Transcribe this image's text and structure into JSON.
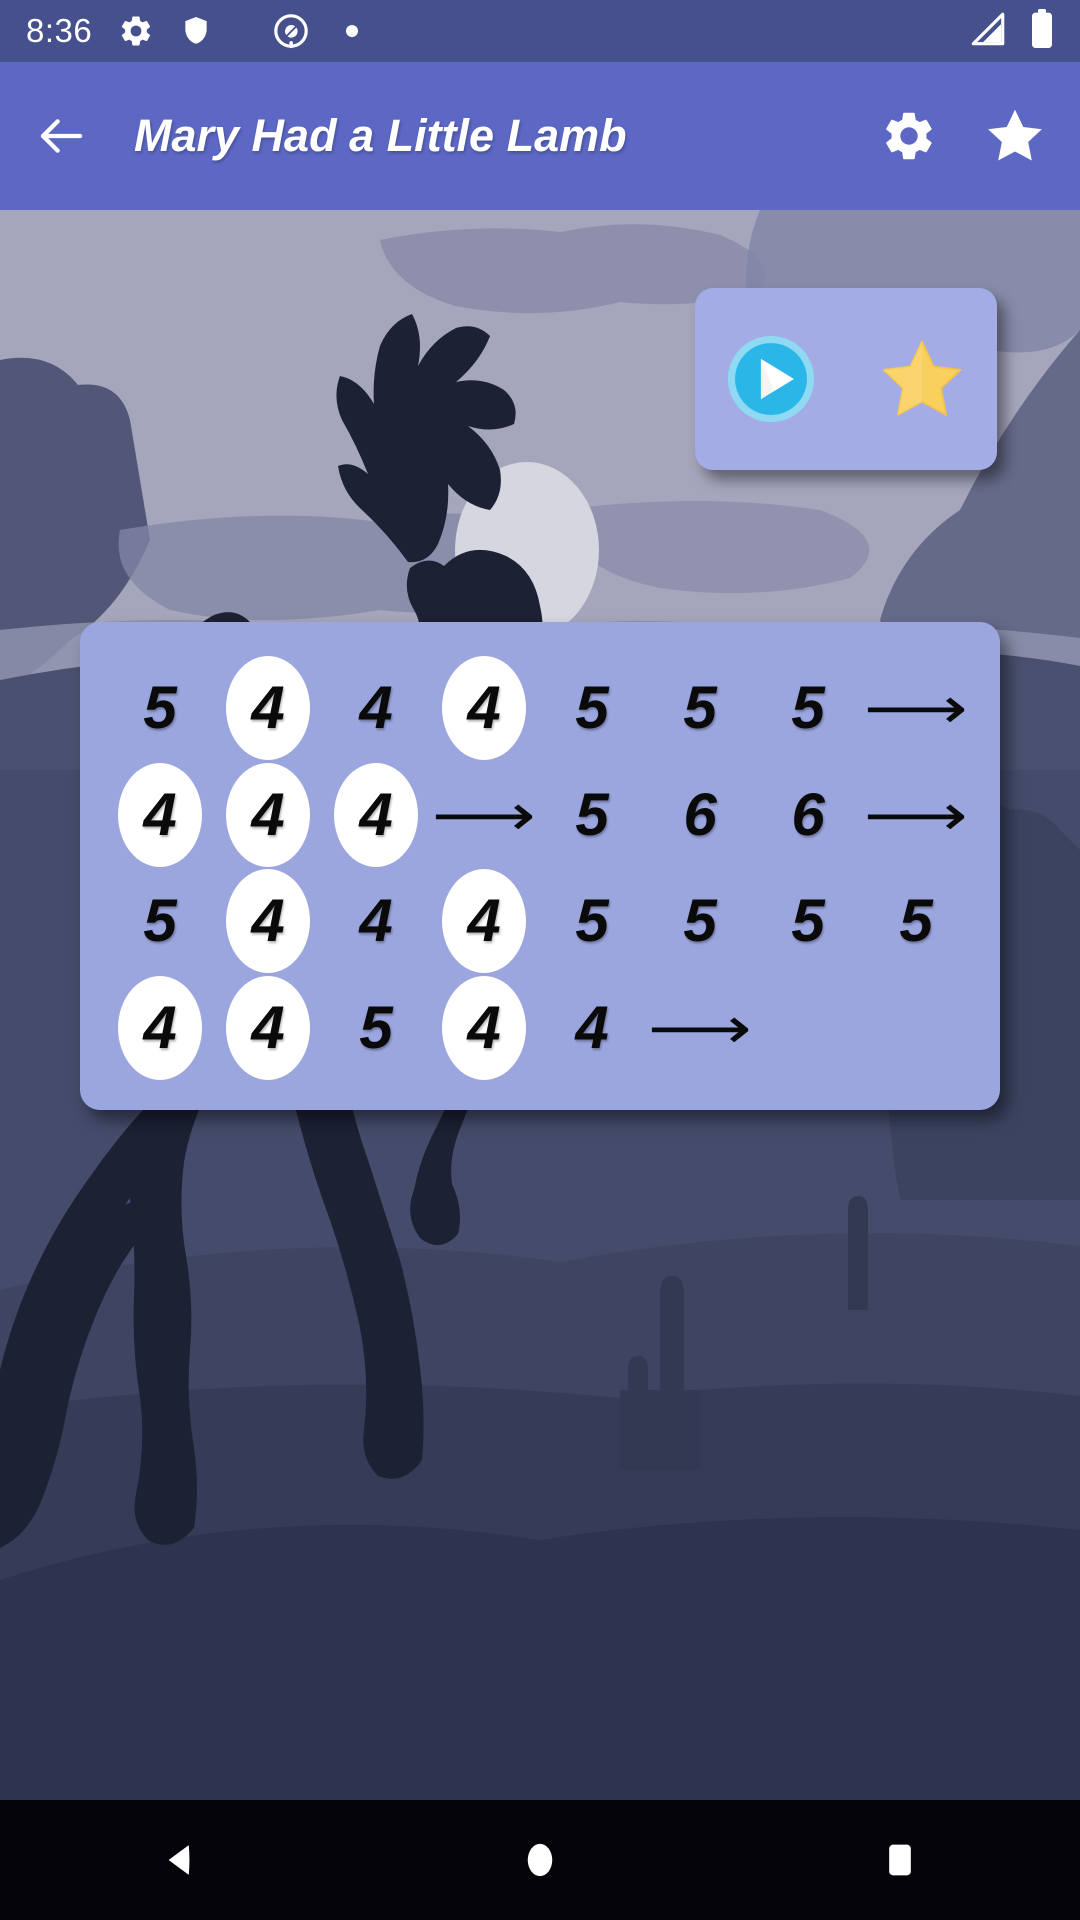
{
  "status_bar": {
    "clock": "8:36",
    "icons": [
      "gear-icon",
      "shield-icon",
      "do-not-disturb-icon",
      "dot-icon"
    ],
    "right_icons": [
      "cell-signal-icon",
      "battery-full-icon"
    ],
    "background_color": "#45508C"
  },
  "app_bar": {
    "back_label": "back-arrow",
    "title": "Mary Had a Little Lamb",
    "actions": [
      "settings-gear",
      "favorite-star"
    ],
    "background_color": "#5C68C4"
  },
  "control_card": {
    "play_label": "play-button",
    "star_label": "favorite-star-button",
    "background_color": "#A3ACE4",
    "play_color": "#29B6E8",
    "star_color": "#F9CF5D"
  },
  "notes_panel": {
    "background_color": "#9BA6DE",
    "arrow_glyph": "⟶",
    "rows": [
      [
        {
          "text": "5",
          "circled": false,
          "type": "note"
        },
        {
          "text": "4",
          "circled": true,
          "type": "note"
        },
        {
          "text": "4",
          "circled": false,
          "type": "note"
        },
        {
          "text": "4",
          "circled": true,
          "type": "note"
        },
        {
          "text": "5",
          "circled": false,
          "type": "note"
        },
        {
          "text": "5",
          "circled": false,
          "type": "note"
        },
        {
          "text": "5",
          "circled": false,
          "type": "note"
        },
        {
          "text": "⟶",
          "circled": false,
          "type": "arrow"
        }
      ],
      [
        {
          "text": "4",
          "circled": true,
          "type": "note"
        },
        {
          "text": "4",
          "circled": true,
          "type": "note"
        },
        {
          "text": "4",
          "circled": true,
          "type": "note"
        },
        {
          "text": "⟶",
          "circled": false,
          "type": "arrow"
        },
        {
          "text": "5",
          "circled": false,
          "type": "note"
        },
        {
          "text": "6",
          "circled": false,
          "type": "note"
        },
        {
          "text": "6",
          "circled": false,
          "type": "note"
        },
        {
          "text": "⟶",
          "circled": false,
          "type": "arrow"
        }
      ],
      [
        {
          "text": "5",
          "circled": false,
          "type": "note"
        },
        {
          "text": "4",
          "circled": true,
          "type": "note"
        },
        {
          "text": "4",
          "circled": false,
          "type": "note"
        },
        {
          "text": "4",
          "circled": true,
          "type": "note"
        },
        {
          "text": "5",
          "circled": false,
          "type": "note"
        },
        {
          "text": "5",
          "circled": false,
          "type": "note"
        },
        {
          "text": "5",
          "circled": false,
          "type": "note"
        },
        {
          "text": "5",
          "circled": false,
          "type": "note"
        }
      ],
      [
        {
          "text": "4",
          "circled": true,
          "type": "note"
        },
        {
          "text": "4",
          "circled": true,
          "type": "note"
        },
        {
          "text": "5",
          "circled": false,
          "type": "note"
        },
        {
          "text": "4",
          "circled": true,
          "type": "note"
        },
        {
          "text": "4",
          "circled": false,
          "type": "note"
        },
        {
          "text": "⟶",
          "circled": false,
          "type": "arrow"
        },
        {
          "text": "",
          "circled": false,
          "type": "empty"
        },
        {
          "text": "",
          "circled": false,
          "type": "empty"
        }
      ]
    ]
  },
  "scene": {
    "description": "night-desert-rearing-horse-silhouette",
    "sky_color": "#A5A6BC",
    "cloud_color": "#8386A6",
    "moon_color": "#D5D6E0",
    "ground_color": "#2E3450",
    "silhouette_color": "#1C2133"
  },
  "nav_bar": {
    "buttons": [
      "back-triangle",
      "home-circle",
      "recents-square"
    ],
    "background_color": "#050509"
  }
}
